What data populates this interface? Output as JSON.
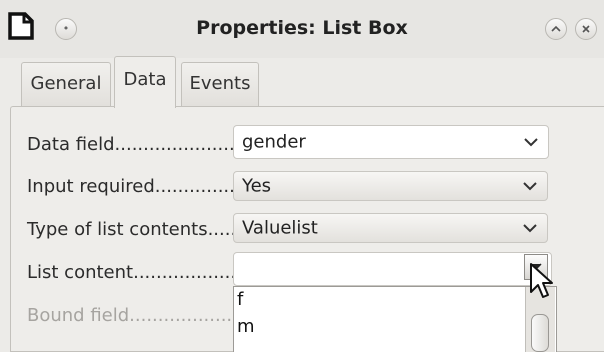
{
  "window": {
    "title": "Properties: List Box"
  },
  "tabs": [
    {
      "label": "General",
      "active": false
    },
    {
      "label": "Data",
      "active": true
    },
    {
      "label": "Events",
      "active": false
    }
  ],
  "fields": {
    "data_field": {
      "label": "Data field........................",
      "value": "gender"
    },
    "input_required": {
      "label": "Input required.................",
      "value": "Yes"
    },
    "type_of_list_contents": {
      "label": "Type of list contents.....",
      "value": "Valuelist"
    },
    "list_content": {
      "label": "List content....................",
      "value": ""
    },
    "bound_field": {
      "label": "Bound field.........................."
    }
  },
  "list_popup": {
    "items": [
      "f",
      "m"
    ]
  },
  "icons": {
    "app": "document-icon",
    "menu": "window-menu-icon",
    "minimize": "minimize-icon",
    "close": "close-icon",
    "dropdown": "chevron-down-icon",
    "cursor": "mouse-pointer-icon"
  }
}
